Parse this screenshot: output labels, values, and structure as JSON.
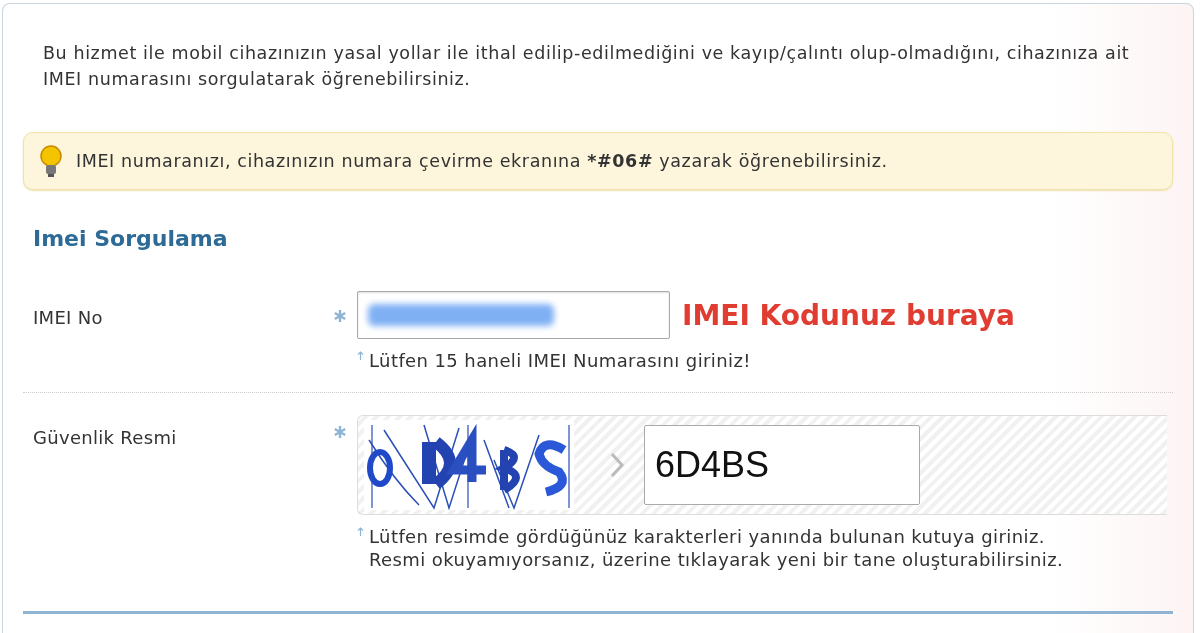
{
  "intro": "Bu hizmet ile mobil cihazınızın yasal yollar ile ithal edilip-edilmediğini ve kayıp/çalıntı olup-olmadığını, cihazınıza ait IMEI numarasını sorgulatarak öğrenebilirsiniz.",
  "tip": {
    "before": "IMEI numaranızı, cihazınızın numara çevirme ekranına ",
    "code": "*#06#",
    "after": " yazarak öğrenebilirsiniz."
  },
  "heading": "Imei Sorgulama",
  "fields": [
    {
      "kind": "text",
      "label": "IMEI No",
      "required": true,
      "redacted": true,
      "annotation": "IMEI Kodunuz buraya",
      "hint_lines": [
        "Lütfen 15 haneli IMEI Numarasını giriniz!"
      ]
    },
    {
      "kind": "captcha",
      "label": "Güvenlik Resmi",
      "required": true,
      "value": "6D4BS",
      "hint_lines": [
        "Lütfen resimde gördüğünüz karakterleri yanında bulunan kutuya giriniz.",
        "Resmi okuyamıyorsanız, üzerine tıklayarak yeni bir tane oluşturabilirsiniz."
      ]
    }
  ]
}
